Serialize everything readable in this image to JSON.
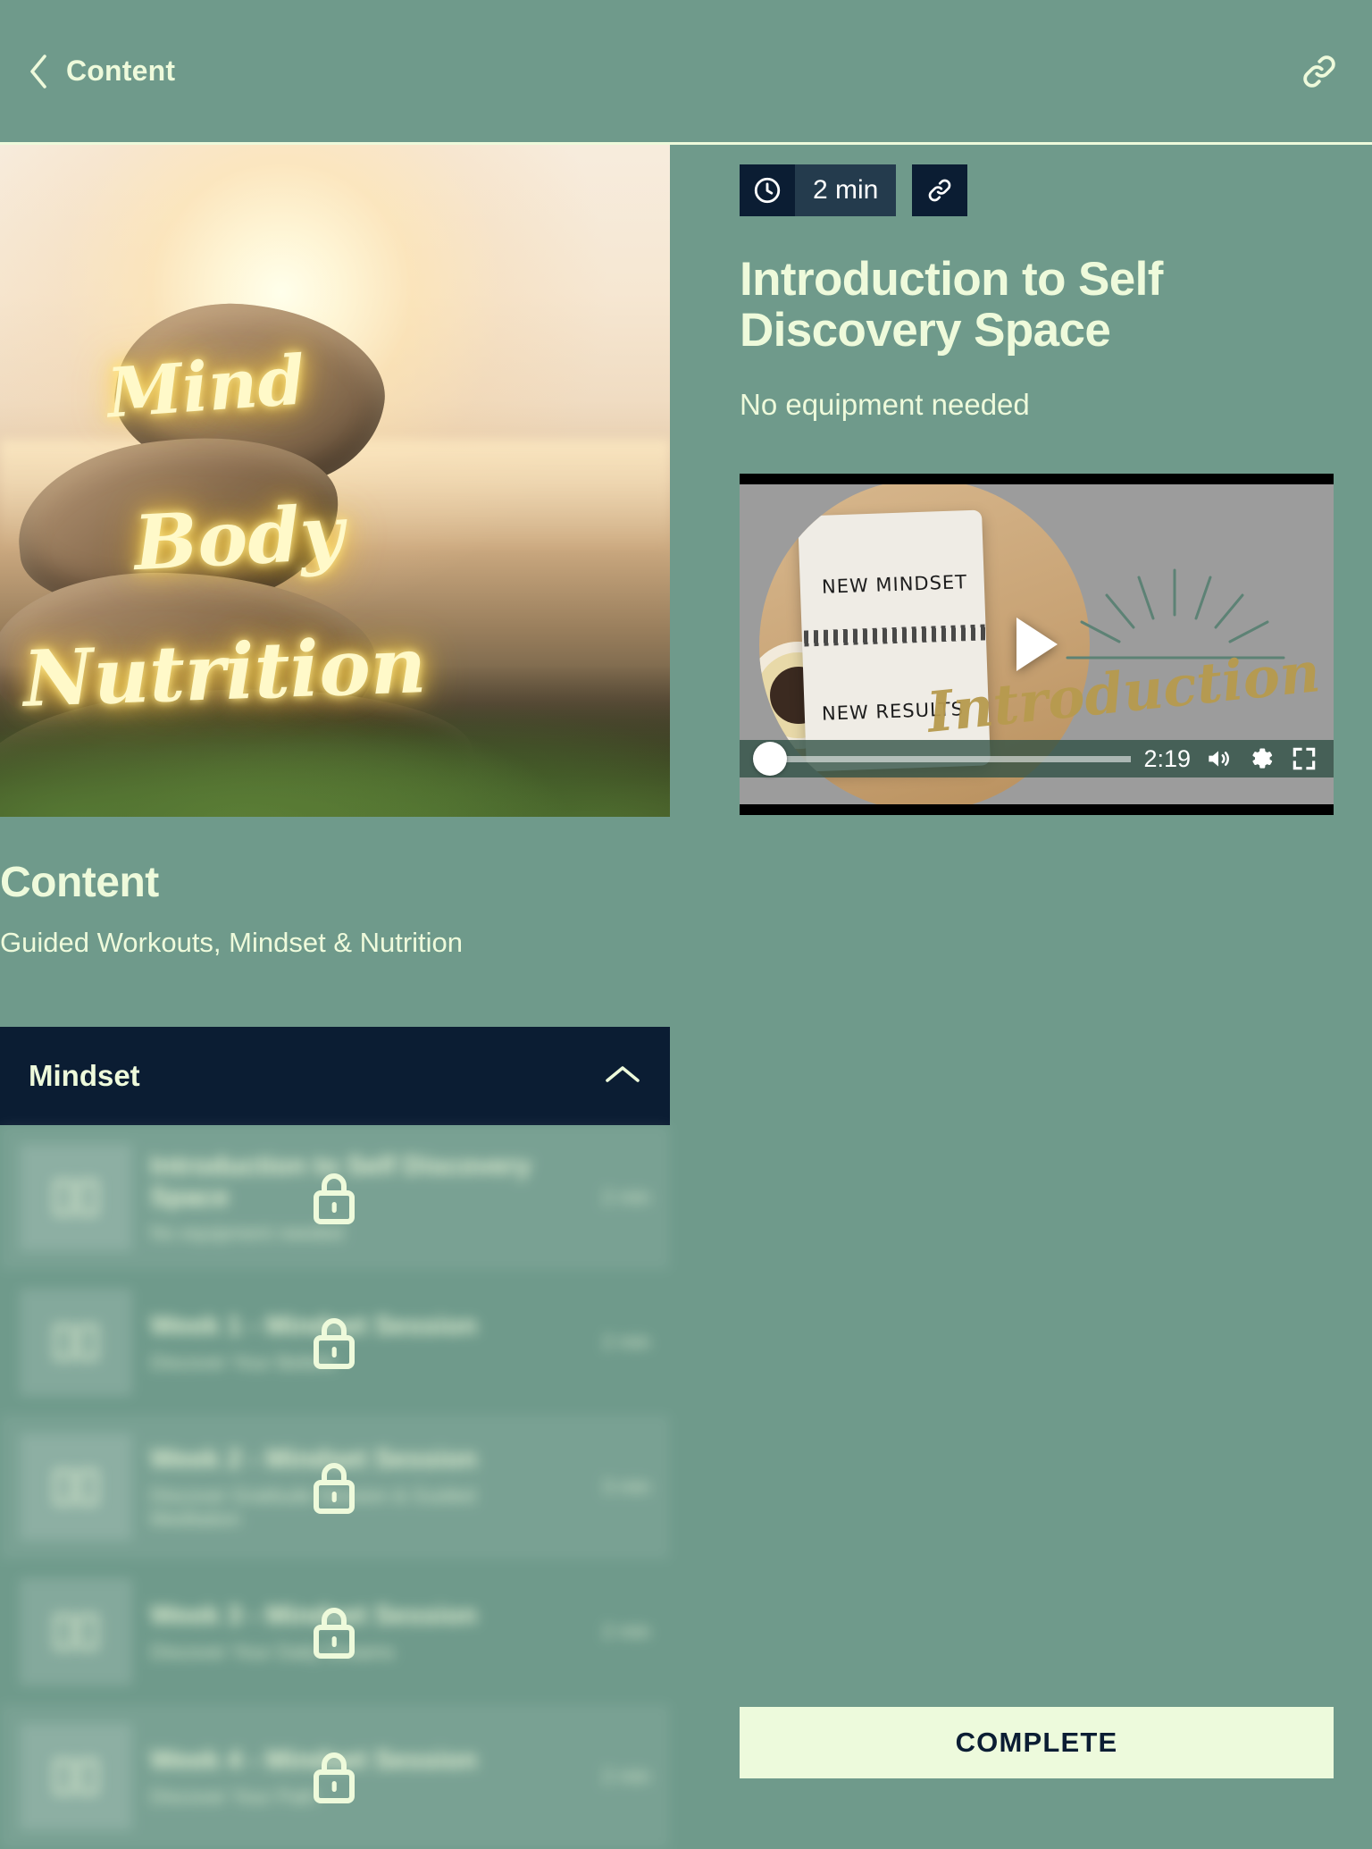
{
  "topbar": {
    "back_label": "Content",
    "back_icon": "chevron-left-icon",
    "link_icon": "link-icon"
  },
  "hero": {
    "word1": "Mind",
    "word2": "Body",
    "word3": "Nutrition"
  },
  "content_section": {
    "heading": "Content",
    "subtitle": "Guided Workouts, Mindset & Nutrition"
  },
  "accordion": {
    "title": "Mindset",
    "chevron_icon": "chevron-up-icon",
    "expanded": true
  },
  "lessons": [
    {
      "title": "Introduction to Self Discovery Space",
      "subtitle": "No equipment needed",
      "duration": "2 min",
      "locked": true,
      "lock_icon": "lock-icon",
      "thumb_icon": "book-icon"
    },
    {
      "title": "Week 1 - Mindset Session",
      "subtitle": "Discover Your Beliefs",
      "duration": "2 min",
      "locked": true,
      "lock_icon": "lock-icon",
      "thumb_icon": "book-icon"
    },
    {
      "title": "Week 2 - Mindset Session",
      "subtitle": "Discover Gratitude Session & Guided Meditation",
      "duration": "3 min",
      "locked": true,
      "lock_icon": "lock-icon",
      "thumb_icon": "book-icon"
    },
    {
      "title": "Week 3 - Mindset Session",
      "subtitle": "Discover Your Daily Dreams",
      "duration": "2 min",
      "locked": true,
      "lock_icon": "lock-icon",
      "thumb_icon": "book-icon"
    },
    {
      "title": "Week 4 - Mindset Session",
      "subtitle": "Discover Your Path",
      "duration": "2 min",
      "locked": true,
      "lock_icon": "lock-icon",
      "thumb_icon": "book-icon"
    }
  ],
  "detail": {
    "duration_badge": "2 min",
    "clock_icon": "clock-icon",
    "link_icon": "link-icon",
    "title": "Introduction to Self Discovery Space",
    "subtitle": "No equipment needed"
  },
  "player": {
    "play_icon": "play-icon",
    "time_remaining": "2:19",
    "volume_icon": "volume-up-icon",
    "settings_icon": "gear-icon",
    "fullscreen_icon": "fullscreen-icon",
    "thumbnail_line1": "NEW MINDSET",
    "thumbnail_line2": "NEW RESULTS",
    "thumbnail_script": "Introduction",
    "progress_percent": 3
  },
  "footer": {
    "complete_label": "COMPLETE"
  },
  "colors": {
    "background": "#6f9a8b",
    "accent_dark": "#0b1d33",
    "badge_mid": "#243b4d",
    "text_light": "#eefadb",
    "button_bg": "#edfadc"
  }
}
